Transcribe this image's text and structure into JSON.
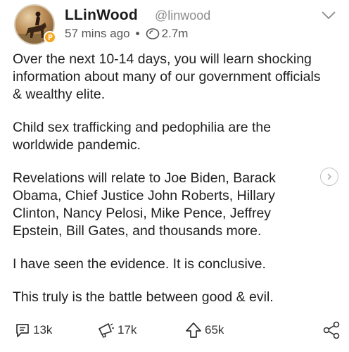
{
  "author": {
    "name": "LLinWood",
    "handle": "@linwood",
    "avatar_icon": "avatar-horse-rider",
    "badge_icon": "parler-badge-icon"
  },
  "meta": {
    "time_ago": "57 mins ago",
    "separator": "•",
    "views": "2.7m",
    "views_icon": "eye-icon"
  },
  "post": {
    "paragraphs": [
      "Over the next 10-14 days, you will learn shocking information about many of our government officials & wealthy elite.",
      "Child sex trafficking and pedophilia are the worldwide pandemic.",
      "Revelations will relate to Joe Biden, Barack Obama, Chief Justice John Roberts, Hillary Clinton, Nancy Pelosi, Mike Pence, Jeffrey Epstein, Bill Gates, and thousands more.",
      "I have seen the evidence. It is conclusive.",
      "This truly is the battle between good & evil."
    ]
  },
  "actions": {
    "replies": "13k",
    "echoes": "17k",
    "upvotes": "65k"
  },
  "colors": {
    "badge": "#f5a623",
    "text": "#1f1f1f",
    "muted": "#8a8a8a"
  }
}
